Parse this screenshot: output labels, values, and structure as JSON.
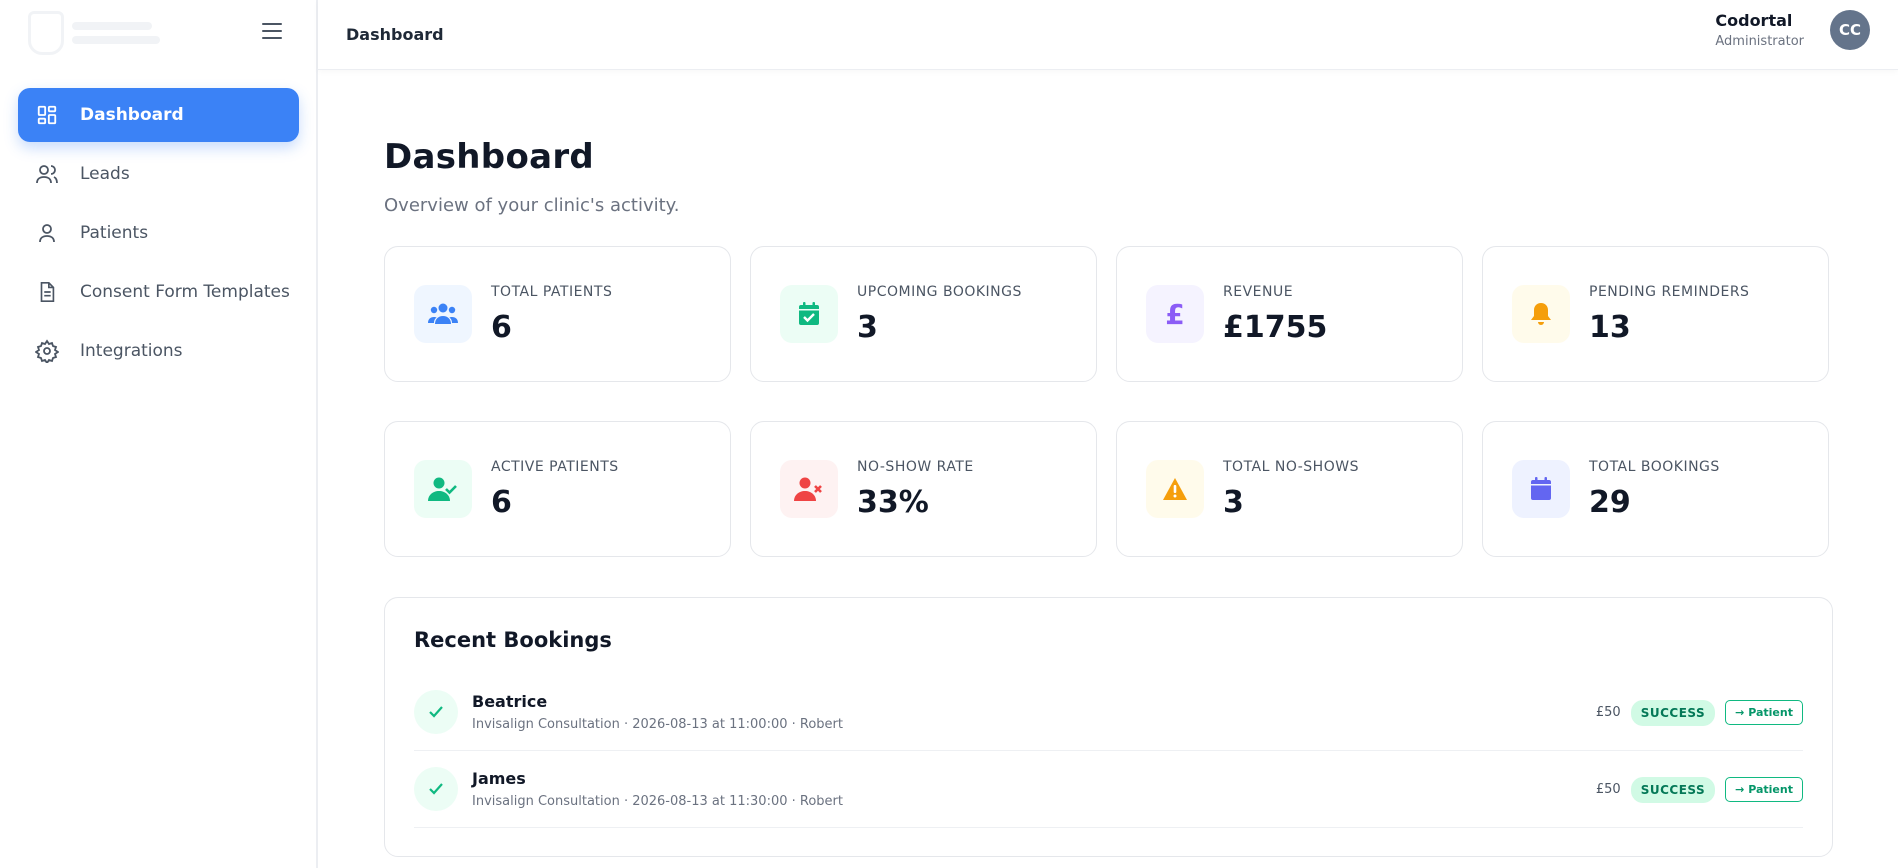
{
  "header": {
    "breadcrumb": "Dashboard",
    "user_name": "Codortal",
    "user_role": "Administrator",
    "avatar_initials": "CC"
  },
  "sidebar": {
    "items": [
      {
        "label": "Dashboard",
        "icon": "grid-icon",
        "active": true
      },
      {
        "label": "Leads",
        "icon": "users-icon",
        "active": false
      },
      {
        "label": "Patients",
        "icon": "user-icon",
        "active": false
      },
      {
        "label": "Consent Form Templates",
        "icon": "document-icon",
        "active": false
      },
      {
        "label": "Integrations",
        "icon": "gear-icon",
        "active": false
      }
    ]
  },
  "page": {
    "title": "Dashboard",
    "subtitle": "Overview of your clinic's activity."
  },
  "stats": [
    {
      "label": "TOTAL PATIENTS",
      "value": "6",
      "icon": "people-icon",
      "color": "#3b82f6",
      "bg": "#eff6ff"
    },
    {
      "label": "UPCOMING BOOKINGS",
      "value": "3",
      "icon": "calendar-check-icon",
      "color": "#10b981",
      "bg": "#ecfdf5"
    },
    {
      "label": "REVENUE",
      "value": "£1755",
      "icon": "pound-icon",
      "color": "#8b5cf6",
      "bg": "#f5f3ff"
    },
    {
      "label": "PENDING REMINDERS",
      "value": "13",
      "icon": "bell-icon",
      "color": "#f59e0b",
      "bg": "#fffbeb"
    },
    {
      "label": "ACTIVE PATIENTS",
      "value": "6",
      "icon": "user-check-icon",
      "color": "#10b981",
      "bg": "#ecfdf5"
    },
    {
      "label": "NO-SHOW RATE",
      "value": "33%",
      "icon": "user-x-icon",
      "color": "#ef4444",
      "bg": "#fef2f2"
    },
    {
      "label": "TOTAL NO-SHOWS",
      "value": "3",
      "icon": "warning-icon",
      "color": "#f59e0b",
      "bg": "#fffbeb"
    },
    {
      "label": "TOTAL BOOKINGS",
      "value": "29",
      "icon": "calendar-icon",
      "color": "#6366f1",
      "bg": "#eef2ff"
    }
  ],
  "recent": {
    "title": "Recent Bookings",
    "rows": [
      {
        "name": "Beatrice",
        "details": "Invisalign Consultation · 2026-08-13 at 11:00:00 · Robert",
        "price": "£50",
        "status": "SUCCESS",
        "action": "→ Patient"
      },
      {
        "name": "James",
        "details": "Invisalign Consultation · 2026-08-13 at 11:30:00 · Robert",
        "price": "£50",
        "status": "SUCCESS",
        "action": "→ Patient"
      }
    ]
  }
}
